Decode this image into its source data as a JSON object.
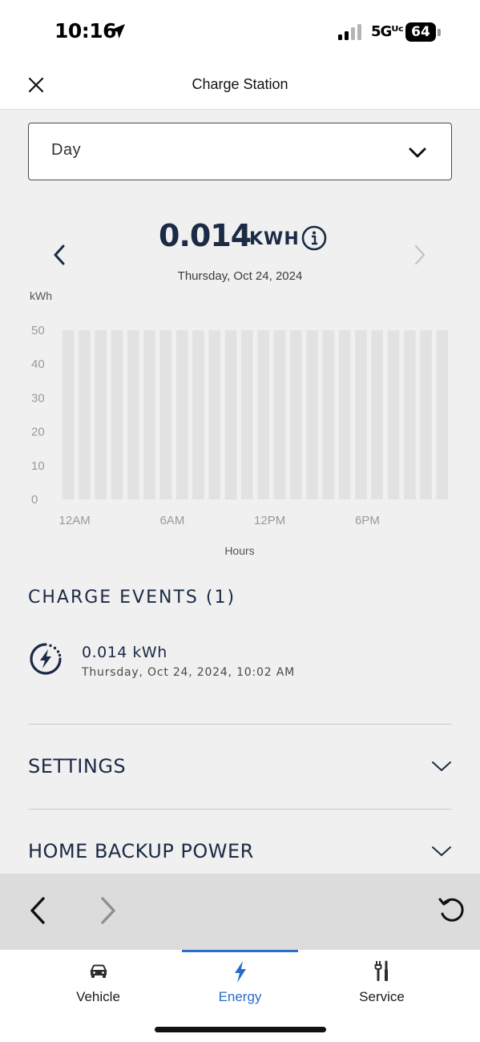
{
  "status_bar": {
    "time": "10:16",
    "network": "5Gᵁᶜ",
    "battery": "64",
    "icons": [
      "location-arrow-icon",
      "signal-bars-icon",
      "battery-icon"
    ]
  },
  "header": {
    "title": "Charge Station",
    "close_icon": "close-icon"
  },
  "period_select": {
    "value": "Day",
    "icon": "chevron-down-icon"
  },
  "summary": {
    "value": "0.014",
    "unit": "KWH",
    "date": "Thursday, Oct 24, 2024",
    "prev_icon": "chevron-left-icon",
    "next_icon": "chevron-right-icon",
    "info_icon": "info-icon"
  },
  "chart_data": {
    "type": "bar",
    "ylabel": "kWh",
    "xlabel": "Hours",
    "ylim": [
      0,
      50
    ],
    "y_ticks": [
      "50",
      "40",
      "30",
      "20",
      "10",
      "0"
    ],
    "x_tick_labels": [
      "12AM",
      "6AM",
      "12PM",
      "6PM"
    ],
    "categories": [
      "12AM",
      "1AM",
      "2AM",
      "3AM",
      "4AM",
      "5AM",
      "6AM",
      "7AM",
      "8AM",
      "9AM",
      "10AM",
      "11AM",
      "12PM",
      "1PM",
      "2PM",
      "3PM",
      "4PM",
      "5PM",
      "6PM",
      "7PM",
      "8PM",
      "9PM",
      "10PM",
      "11PM"
    ],
    "series": [
      {
        "values": [
          0,
          0,
          0,
          0,
          0,
          0,
          0,
          0,
          0,
          0,
          0.014,
          0,
          0,
          0,
          0,
          0,
          0,
          0,
          0,
          0,
          0,
          0,
          0,
          0
        ]
      }
    ],
    "background_bar_color": "#e2e2e2",
    "grid": false
  },
  "charge_events": {
    "title": "CHARGE EVENTS (1)",
    "items": [
      {
        "amount": "0.014 kWh",
        "time": "Thursday, Oct 24, 2024, 10:02 AM",
        "icon": "charging-bolt-icon"
      }
    ]
  },
  "sections": [
    {
      "label": "SETTINGS",
      "icon": "chevron-down-icon"
    },
    {
      "label": "HOME BACKUP POWER",
      "icon": "chevron-down-icon"
    }
  ],
  "browser_toolbar": {
    "icons": [
      "back-arrow-icon",
      "forward-arrow-icon",
      "reload-icon"
    ]
  },
  "tab_bar": {
    "active": "Energy",
    "tabs": [
      {
        "label": "Vehicle",
        "icon": "car-icon"
      },
      {
        "label": "Energy",
        "icon": "lightning-icon"
      },
      {
        "label": "Service",
        "icon": "tools-icon"
      }
    ]
  },
  "colors": {
    "navy": "#1b2a45",
    "accent_blue": "#2a6cc8",
    "bar_gray": "#e2e2e2",
    "browser_bar": "#dcdcdc"
  }
}
